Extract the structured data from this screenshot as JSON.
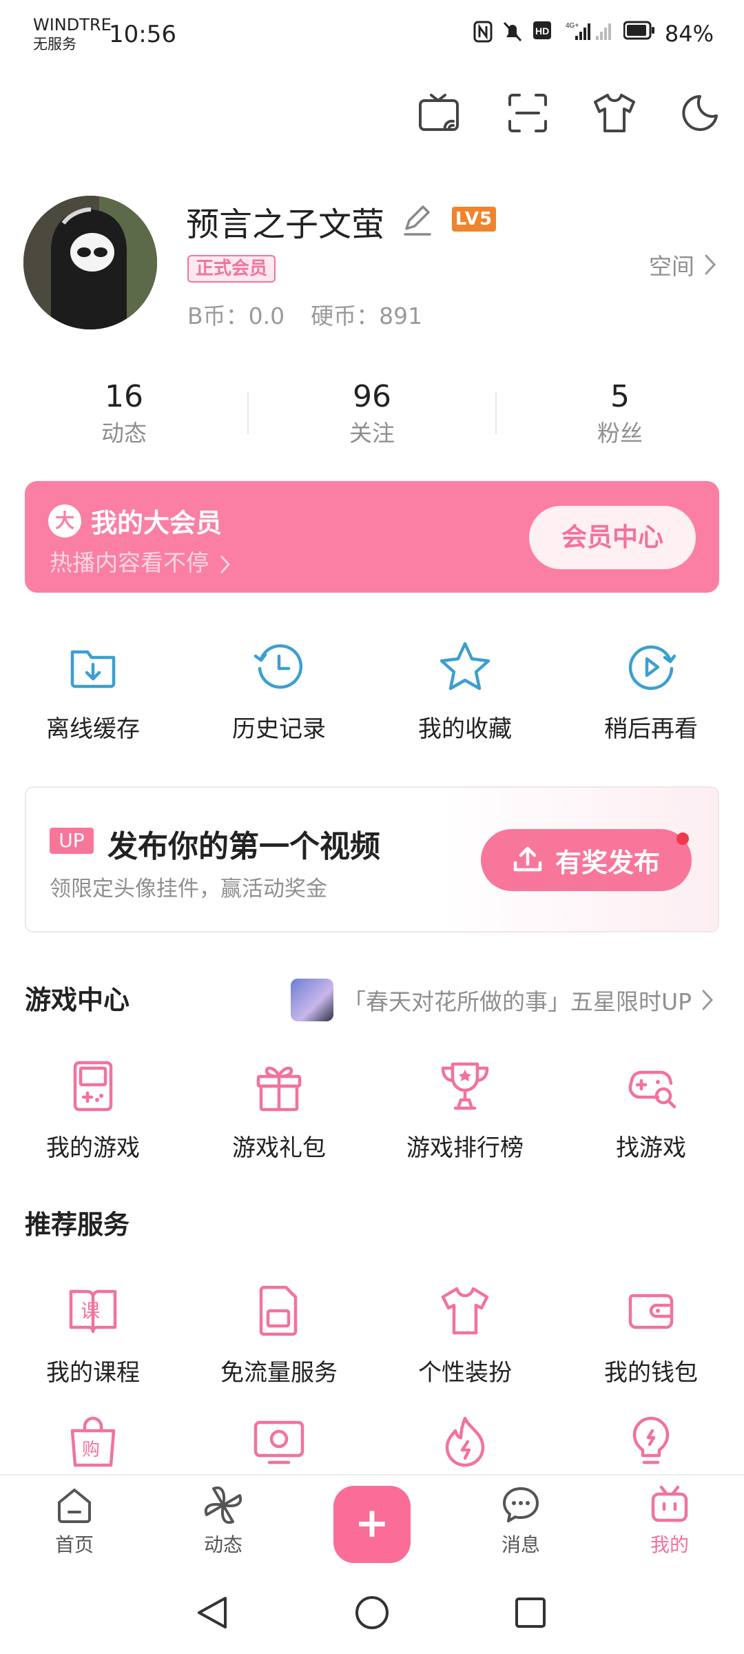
{
  "status_bar": {
    "carrier": "WINDTRE",
    "carrier_status": "无服务",
    "time": "10:56",
    "battery": "84%",
    "network": "4G+"
  },
  "header_icons": [
    "tv-cast-icon",
    "scan-icon",
    "theme-shirt-icon",
    "night-mode-icon"
  ],
  "profile": {
    "username": "预言之子文萤",
    "level": "LV5",
    "member_badge": "正式会员",
    "b_coins": "B币：0.0",
    "hard_coins": "硬币：891",
    "space_link": "空间"
  },
  "stats": [
    {
      "value": "16",
      "label": "动态"
    },
    {
      "value": "96",
      "label": "关注"
    },
    {
      "value": "5",
      "label": "粉丝"
    }
  ],
  "vip": {
    "logo": "大",
    "title": "我的大会员",
    "subtitle": "热播内容看不停",
    "button": "会员中心"
  },
  "quick_actions": [
    {
      "label": "离线缓存",
      "icon": "download-folder-icon"
    },
    {
      "label": "历史记录",
      "icon": "history-clock-icon"
    },
    {
      "label": "我的收藏",
      "icon": "star-icon"
    },
    {
      "label": "稍后再看",
      "icon": "watch-later-icon"
    }
  ],
  "upload_card": {
    "tag": "UP",
    "title": "发布你的第一个视频",
    "subtitle": "领限定头像挂件，赢活动奖金",
    "button": "有奖发布"
  },
  "game_center": {
    "title": "游戏中心",
    "promo": "「春天对花所做的事」五星限时UP",
    "items": [
      {
        "label": "我的游戏",
        "icon": "game-console-icon"
      },
      {
        "label": "游戏礼包",
        "icon": "gift-icon"
      },
      {
        "label": "游戏排行榜",
        "icon": "trophy-icon"
      },
      {
        "label": "找游戏",
        "icon": "gamepad-search-icon"
      }
    ]
  },
  "services": {
    "title": "推荐服务",
    "items": [
      {
        "label": "我的课程",
        "icon": "course-book-icon"
      },
      {
        "label": "免流量服务",
        "icon": "sim-card-icon"
      },
      {
        "label": "个性装扮",
        "icon": "shirt-icon"
      },
      {
        "label": "我的钱包",
        "icon": "wallet-icon"
      }
    ],
    "row2_icons": [
      "shopping-bag-icon",
      "tv-screen-icon",
      "flame-icon",
      "lightbulb-icon"
    ]
  },
  "bottom_nav": [
    {
      "label": "首页",
      "icon": "home-icon"
    },
    {
      "label": "动态",
      "icon": "pinwheel-icon"
    },
    {
      "label": "消息",
      "icon": "message-bubble-icon"
    },
    {
      "label": "我的",
      "icon": "tv-mascot-icon"
    }
  ],
  "fab_label": "+",
  "colors": {
    "accent_pink": "#f2729c",
    "vip_card": "#fb7fa3",
    "blue_icon": "#3b9fd1",
    "level_orange": "#f0832b"
  }
}
